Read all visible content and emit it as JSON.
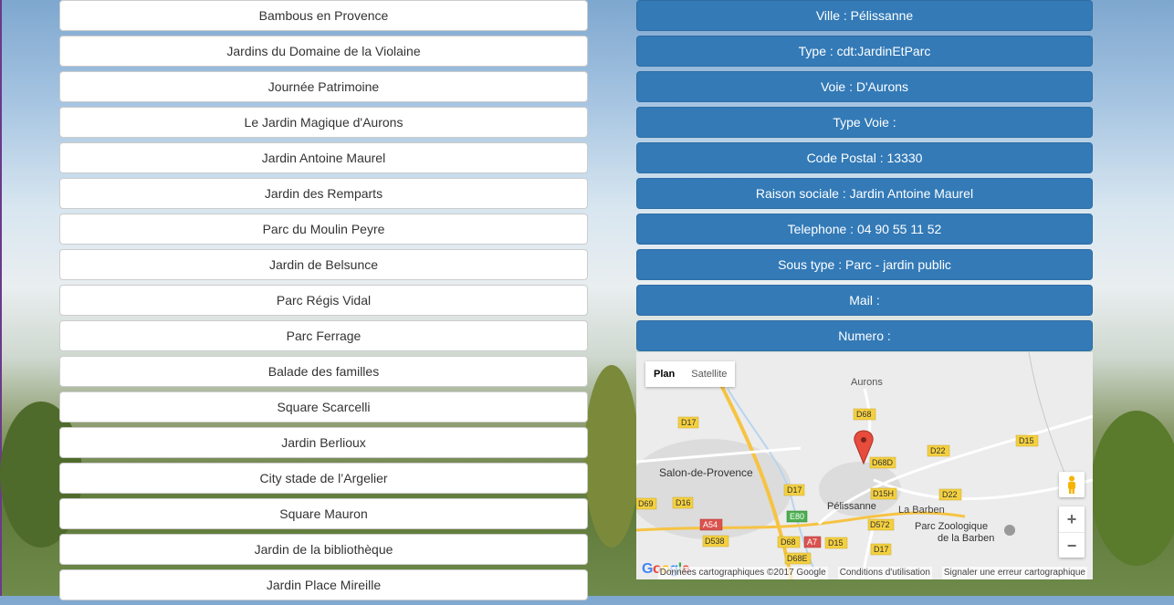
{
  "gardens": [
    "Bambous en Provence",
    "Jardins du Domaine de la Violaine",
    "Journée Patrimoine",
    "Le Jardin Magique d'Aurons",
    "Jardin Antoine Maurel",
    "Jardin des Remparts",
    "Parc du Moulin Peyre",
    "Jardin de Belsunce",
    "Parc Régis Vidal",
    "Parc Ferrage",
    "Balade des familles",
    "Square Scarcelli",
    "Jardin Berlioux",
    "City stade de l’Argelier",
    "Square Mauron",
    "Jardin de la bibliothèque",
    "Jardin Place Mireille"
  ],
  "details": [
    "Ville : Pélissanne",
    "Type : cdt:JardinEtParc",
    "Voie : D'Aurons",
    "Type Voie :",
    "Code Postal : 13330",
    "Raison sociale : Jardin Antoine Maurel",
    "Telephone : 04 90 55 11 52",
    "Sous type : Parc - jardin public",
    "Mail :",
    "Numero :"
  ],
  "map": {
    "toggle_plan": "Plan",
    "toggle_satellite": "Satellite",
    "zoom_in": "+",
    "zoom_out": "−",
    "places": {
      "aurons": "Aurons",
      "salon": "Salon-de-Provence",
      "pelissanne": "Pélissanne",
      "labarben": "La Barben",
      "parc_zoo_1": "Parc Zoologique",
      "parc_zoo_2": "de la Barben"
    },
    "roads": {
      "d68": "D68",
      "d17a": "D17",
      "d68d": "D68D",
      "d22a": "D22",
      "d15a": "D15",
      "d17b": "D17",
      "d15h": "D15H",
      "d22b": "D22",
      "d69": "D69",
      "d16": "D16",
      "e80": "E80",
      "a54": "A54",
      "d572": "D572",
      "d538": "D538",
      "d68b": "D68",
      "a7": "A7",
      "d15b": "D15",
      "d17c": "D17",
      "d68e": "D68E"
    },
    "footer": {
      "data": "Données cartographiques ©2017 Google",
      "terms": "Conditions d'utilisation",
      "report": "Signaler une erreur cartographique"
    },
    "colors": {
      "road_label_bg": "#f4d03f",
      "highway_label_bg": "#d9534f",
      "marker": "#e74c3c"
    }
  }
}
